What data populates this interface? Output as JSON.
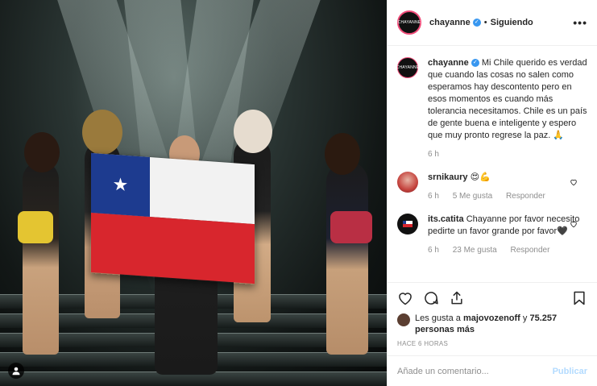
{
  "post": {
    "account": "chayanne",
    "avatar_text": "CHAYANNE",
    "follow_label": "Siguiendo",
    "separator": "•",
    "more_label": "•••",
    "flag_star": "★"
  },
  "caption": {
    "username": "chayanne",
    "text": "Mi Chile querido es verdad que cuando las cosas no salen como esperamos hay descontento pero en esos momentos es cuando más tolerancia necesitamos. Chile es un país de gente buena e inteligente y espero que muy pronto regrese la paz. 🙏",
    "time": "6 h"
  },
  "comments": [
    {
      "username": "srnikaury",
      "text": "😍💪",
      "time": "6 h",
      "likes": "5 Me gusta",
      "reply": "Responder"
    },
    {
      "username": "its.catita",
      "text": "Chayanne por favor necesito pedirte un favor grande por favor🖤",
      "time": "6 h",
      "likes": "23 Me gusta",
      "reply": "Responder"
    }
  ],
  "likes": {
    "prefix": "Les gusta a",
    "user": "majovozenoff",
    "conjunction": "y",
    "others": "75.257 personas más"
  },
  "timestamp": "HACE 6 HORAS",
  "add_comment": {
    "placeholder": "Añade un comentario...",
    "publish_label": "Publicar"
  },
  "colors": {
    "verified": "#3897f0",
    "story_ring": "#ef4b78",
    "publish_disabled": "#b3dbff",
    "muted": "#8e8e8e"
  }
}
